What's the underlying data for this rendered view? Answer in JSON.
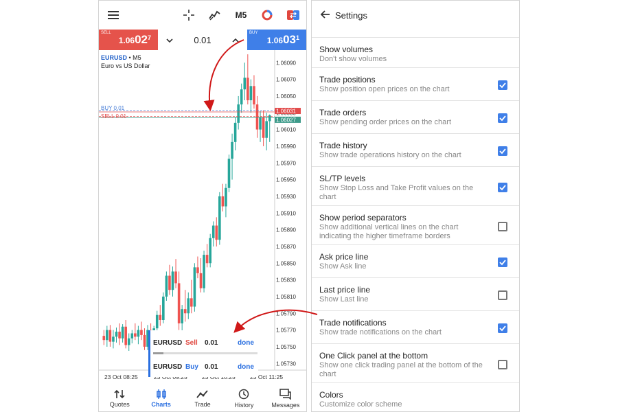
{
  "chart_screen": {
    "timeframe": "M5",
    "sell": {
      "label": "SELL",
      "price_main": "1.06",
      "price_big": "02",
      "price_sup": "7"
    },
    "buy": {
      "label": "BUY",
      "price_main": "1.06",
      "price_big": "03",
      "price_sup": "1"
    },
    "lot": "0.01",
    "symbol": "EURUSD",
    "timeframe_suffix": " • M5",
    "description": "Euro vs US Dollar",
    "price_axis": [
      "1.06090",
      "1.06070",
      "1.06050",
      "1.06030",
      "1.06010",
      "1.05990",
      "1.05970",
      "1.05950",
      "1.05930",
      "1.05910",
      "1.05890",
      "1.05870",
      "1.05850",
      "1.05830",
      "1.05810",
      "1.05790",
      "1.05770",
      "1.05750",
      "1.05730"
    ],
    "buy_line_label": "BUY 0.01",
    "sell_line_label": "SELL 0.01",
    "marker_ask": "1.06031",
    "marker_bid": "1.06027",
    "time_axis": [
      "23 Oct 08:25",
      "23 Oct 09:25",
      "23 Oct 10:25",
      "23 Oct 11:25"
    ],
    "one_click": [
      {
        "symbol": "EURUSD",
        "side": "Sell",
        "volume": "0.01",
        "status": "done"
      },
      {
        "symbol": "EURUSD",
        "side": "Buy",
        "volume": "0.01",
        "status": "done"
      }
    ],
    "nav": [
      {
        "label": "Quotes",
        "icon": "quotes-icon"
      },
      {
        "label": "Charts",
        "icon": "charts-icon",
        "active": true
      },
      {
        "label": "Trade",
        "icon": "trade-icon"
      },
      {
        "label": "History",
        "icon": "history-icon"
      },
      {
        "label": "Messages",
        "icon": "messages-icon"
      }
    ],
    "colors": {
      "bull": "#26a69a",
      "bear": "#ef5350",
      "sell": "#e5534b",
      "buy": "#3f7fe8",
      "accent": "#2a6fe0"
    }
  },
  "settings_screen": {
    "title": "Settings",
    "items": [
      {
        "title": "Show volumes",
        "subtitle": "Don't show volumes",
        "checkbox": null
      },
      {
        "title": "Trade positions",
        "subtitle": "Show position open prices on the chart",
        "checkbox": true
      },
      {
        "title": "Trade orders",
        "subtitle": "Show pending order prices on the chart",
        "checkbox": true
      },
      {
        "title": "Trade history",
        "subtitle": "Show trade operations history on the chart",
        "checkbox": true
      },
      {
        "title": "SL/TP levels",
        "subtitle": "Show Stop Loss and Take Profit values on the chart",
        "checkbox": true
      },
      {
        "title": "Show period separators",
        "subtitle": "Show additional vertical lines on the chart indicating the higher timeframe borders",
        "checkbox": false
      },
      {
        "title": "Ask price line",
        "subtitle": "Show Ask line",
        "checkbox": true
      },
      {
        "title": "Last price line",
        "subtitle": "Show Last line",
        "checkbox": false
      },
      {
        "title": "Trade notifications",
        "subtitle": "Show trade notifications on the chart",
        "checkbox": true
      },
      {
        "title": "One Click panel at the bottom",
        "subtitle": "Show one click trading panel at the bottom of the chart",
        "checkbox": false
      },
      {
        "title": "Colors",
        "subtitle": "Customize color scheme",
        "checkbox": null
      }
    ]
  },
  "chart_data": {
    "type": "candlestick",
    "series": [
      {
        "o": 1.05763,
        "h": 1.0577,
        "l": 1.05752,
        "c": 1.05758
      },
      {
        "o": 1.05758,
        "h": 1.05775,
        "l": 1.0575,
        "c": 1.0577
      },
      {
        "o": 1.0577,
        "h": 1.05776,
        "l": 1.0575,
        "c": 1.05756
      },
      {
        "o": 1.05756,
        "h": 1.0577,
        "l": 1.05748,
        "c": 1.05762
      },
      {
        "o": 1.05762,
        "h": 1.05773,
        "l": 1.05755,
        "c": 1.05768
      },
      {
        "o": 1.05768,
        "h": 1.05778,
        "l": 1.05752,
        "c": 1.0576
      },
      {
        "o": 1.0576,
        "h": 1.05777,
        "l": 1.05755,
        "c": 1.05774
      },
      {
        "o": 1.05774,
        "h": 1.05782,
        "l": 1.05748,
        "c": 1.05752
      },
      {
        "o": 1.05752,
        "h": 1.05766,
        "l": 1.05745,
        "c": 1.0576
      },
      {
        "o": 1.0576,
        "h": 1.0577,
        "l": 1.05754,
        "c": 1.05766
      },
      {
        "o": 1.05766,
        "h": 1.05778,
        "l": 1.05758,
        "c": 1.05762
      },
      {
        "o": 1.05762,
        "h": 1.05775,
        "l": 1.05753,
        "c": 1.0577
      },
      {
        "o": 1.0577,
        "h": 1.0578,
        "l": 1.05758,
        "c": 1.05764
      },
      {
        "o": 1.05764,
        "h": 1.05772,
        "l": 1.05746,
        "c": 1.0575
      },
      {
        "o": 1.0575,
        "h": 1.05776,
        "l": 1.05746,
        "c": 1.0577
      },
      {
        "o": 1.0577,
        "h": 1.05778,
        "l": 1.05748,
        "c": 1.05755
      },
      {
        "o": 1.05755,
        "h": 1.05775,
        "l": 1.05752,
        "c": 1.05772
      },
      {
        "o": 1.05772,
        "h": 1.05793,
        "l": 1.05768,
        "c": 1.05788
      },
      {
        "o": 1.05788,
        "h": 1.058,
        "l": 1.05775,
        "c": 1.05782
      },
      {
        "o": 1.05782,
        "h": 1.05815,
        "l": 1.05778,
        "c": 1.0581
      },
      {
        "o": 1.0581,
        "h": 1.0584,
        "l": 1.05805,
        "c": 1.05835
      },
      {
        "o": 1.05835,
        "h": 1.05848,
        "l": 1.05812,
        "c": 1.05818
      },
      {
        "o": 1.05818,
        "h": 1.05846,
        "l": 1.0581,
        "c": 1.0584
      },
      {
        "o": 1.0584,
        "h": 1.05855,
        "l": 1.0582,
        "c": 1.05826
      },
      {
        "o": 1.05826,
        "h": 1.0584,
        "l": 1.0577,
        "c": 1.05778
      },
      {
        "o": 1.05778,
        "h": 1.058,
        "l": 1.05768,
        "c": 1.05795
      },
      {
        "o": 1.05795,
        "h": 1.05818,
        "l": 1.0578,
        "c": 1.0579
      },
      {
        "o": 1.0579,
        "h": 1.05815,
        "l": 1.05783,
        "c": 1.05808
      },
      {
        "o": 1.05808,
        "h": 1.0583,
        "l": 1.0579,
        "c": 1.05798
      },
      {
        "o": 1.05798,
        "h": 1.0585,
        "l": 1.05792,
        "c": 1.05845
      },
      {
        "o": 1.05845,
        "h": 1.05858,
        "l": 1.05832,
        "c": 1.05838
      },
      {
        "o": 1.05838,
        "h": 1.05856,
        "l": 1.05815,
        "c": 1.0582
      },
      {
        "o": 1.0582,
        "h": 1.05865,
        "l": 1.05815,
        "c": 1.0586
      },
      {
        "o": 1.0586,
        "h": 1.05873,
        "l": 1.05845,
        "c": 1.0585
      },
      {
        "o": 1.0585,
        "h": 1.05885,
        "l": 1.05845,
        "c": 1.0588
      },
      {
        "o": 1.0588,
        "h": 1.059,
        "l": 1.0587,
        "c": 1.05895
      },
      {
        "o": 1.05895,
        "h": 1.05905,
        "l": 1.0587,
        "c": 1.05878
      },
      {
        "o": 1.05878,
        "h": 1.05935,
        "l": 1.05872,
        "c": 1.0593
      },
      {
        "o": 1.0593,
        "h": 1.05945,
        "l": 1.05912,
        "c": 1.05918
      },
      {
        "o": 1.05918,
        "h": 1.05945,
        "l": 1.05905,
        "c": 1.0594
      },
      {
        "o": 1.0594,
        "h": 1.0598,
        "l": 1.05935,
        "c": 1.05975
      },
      {
        "o": 1.05975,
        "h": 1.06005,
        "l": 1.0595,
        "c": 1.05995
      },
      {
        "o": 1.05995,
        "h": 1.06025,
        "l": 1.05985,
        "c": 1.06018
      },
      {
        "o": 1.06018,
        "h": 1.0605,
        "l": 1.0601,
        "c": 1.0604
      },
      {
        "o": 1.0604,
        "h": 1.06065,
        "l": 1.0603,
        "c": 1.06058
      },
      {
        "o": 1.06058,
        "h": 1.0609,
        "l": 1.06045,
        "c": 1.06072
      },
      {
        "o": 1.06072,
        "h": 1.061,
        "l": 1.0604,
        "c": 1.06045
      },
      {
        "o": 1.06045,
        "h": 1.0607,
        "l": 1.0603,
        "c": 1.06062
      },
      {
        "o": 1.06062,
        "h": 1.06075,
        "l": 1.06035,
        "c": 1.0604
      },
      {
        "o": 1.0604,
        "h": 1.0605,
        "l": 1.06,
        "c": 1.0601
      },
      {
        "o": 1.0601,
        "h": 1.06032,
        "l": 1.05995,
        "c": 1.06025
      },
      {
        "o": 1.06025,
        "h": 1.06033,
        "l": 1.0599,
        "c": 1.06
      },
      {
        "o": 1.06,
        "h": 1.0603,
        "l": 1.05985,
        "c": 1.0602
      },
      {
        "o": 1.0602,
        "h": 1.06028,
        "l": 1.05995,
        "c": 1.06027
      }
    ],
    "ylim": [
      1.05722,
      1.06105
    ],
    "ask": 1.06031,
    "bid": 1.06027
  }
}
